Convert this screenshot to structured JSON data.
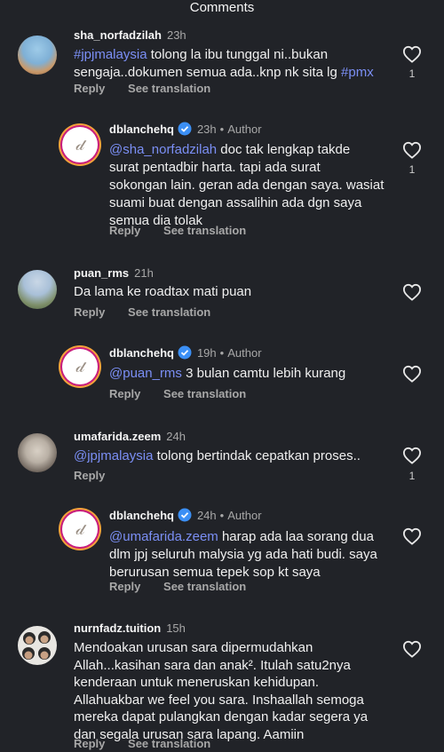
{
  "header": {
    "title": "Comments"
  },
  "actions": {
    "reply": "Reply",
    "see_translation": "See translation"
  },
  "comments": [
    {
      "username": "sha_norfadzilah",
      "time": "23h",
      "mention1": "#jpjmalaysia",
      "line1_rest": " tolong la ibu tunggal ni..bukan",
      "line2": "sengaja..dokumen semua ada..knp nk sita lg ",
      "mention2": "#pmx",
      "likes": "1"
    },
    {
      "username": "dblanchehq",
      "time": "23h",
      "author_label": "Author",
      "mention1": "@sha_norfadzilah",
      "line1_rest": " doc tak lengkap takde",
      "line2": "surat pentadbir harta. tapi ada surat",
      "line3": "sokongan lain. geran ada dengan saya. wasiat",
      "line4": "suami buat dengan assalihin ada dgn saya",
      "line5": "semua dia tolak",
      "likes": "1"
    },
    {
      "username": "puan_rms",
      "time": "21h",
      "line1": "Da lama ke roadtax mati puan"
    },
    {
      "username": "dblanchehq",
      "time": "19h",
      "author_label": "Author",
      "mention1": "@puan_rms",
      "line1_rest": " 3 bulan camtu lebih kurang"
    },
    {
      "username": "umafarida.zeem",
      "time": "24h",
      "mention1": "@jpjmalaysia",
      "line1_rest": " tolong bertindak cepatkan proses..",
      "likes": "1"
    },
    {
      "username": "dblanchehq",
      "time": "24h",
      "author_label": "Author",
      "mention1": "@umafarida.zeem",
      "line1_rest": " harap ada laa sorang dua",
      "line2": "dlm jpj seluruh malysia yg ada hati budi. saya",
      "line3": "berurusan semua tepek sop kt saya"
    },
    {
      "username": "nurnfadz.tuition",
      "time": "15h",
      "line1": "Mendoakan urusan sara dipermudahkan",
      "line2": "Allah...kasihan sara dan anak². Itulah satu2nya",
      "line3": "kenderaan untuk meneruskan kehidupan.",
      "line4": "Allahuakbar we feel you sara. Inshaallah semoga",
      "line5": "mereka dapat pulangkan dengan kadar segera ya",
      "line6": "dan segala urusan sara lapang. Aamiin"
    }
  ]
}
